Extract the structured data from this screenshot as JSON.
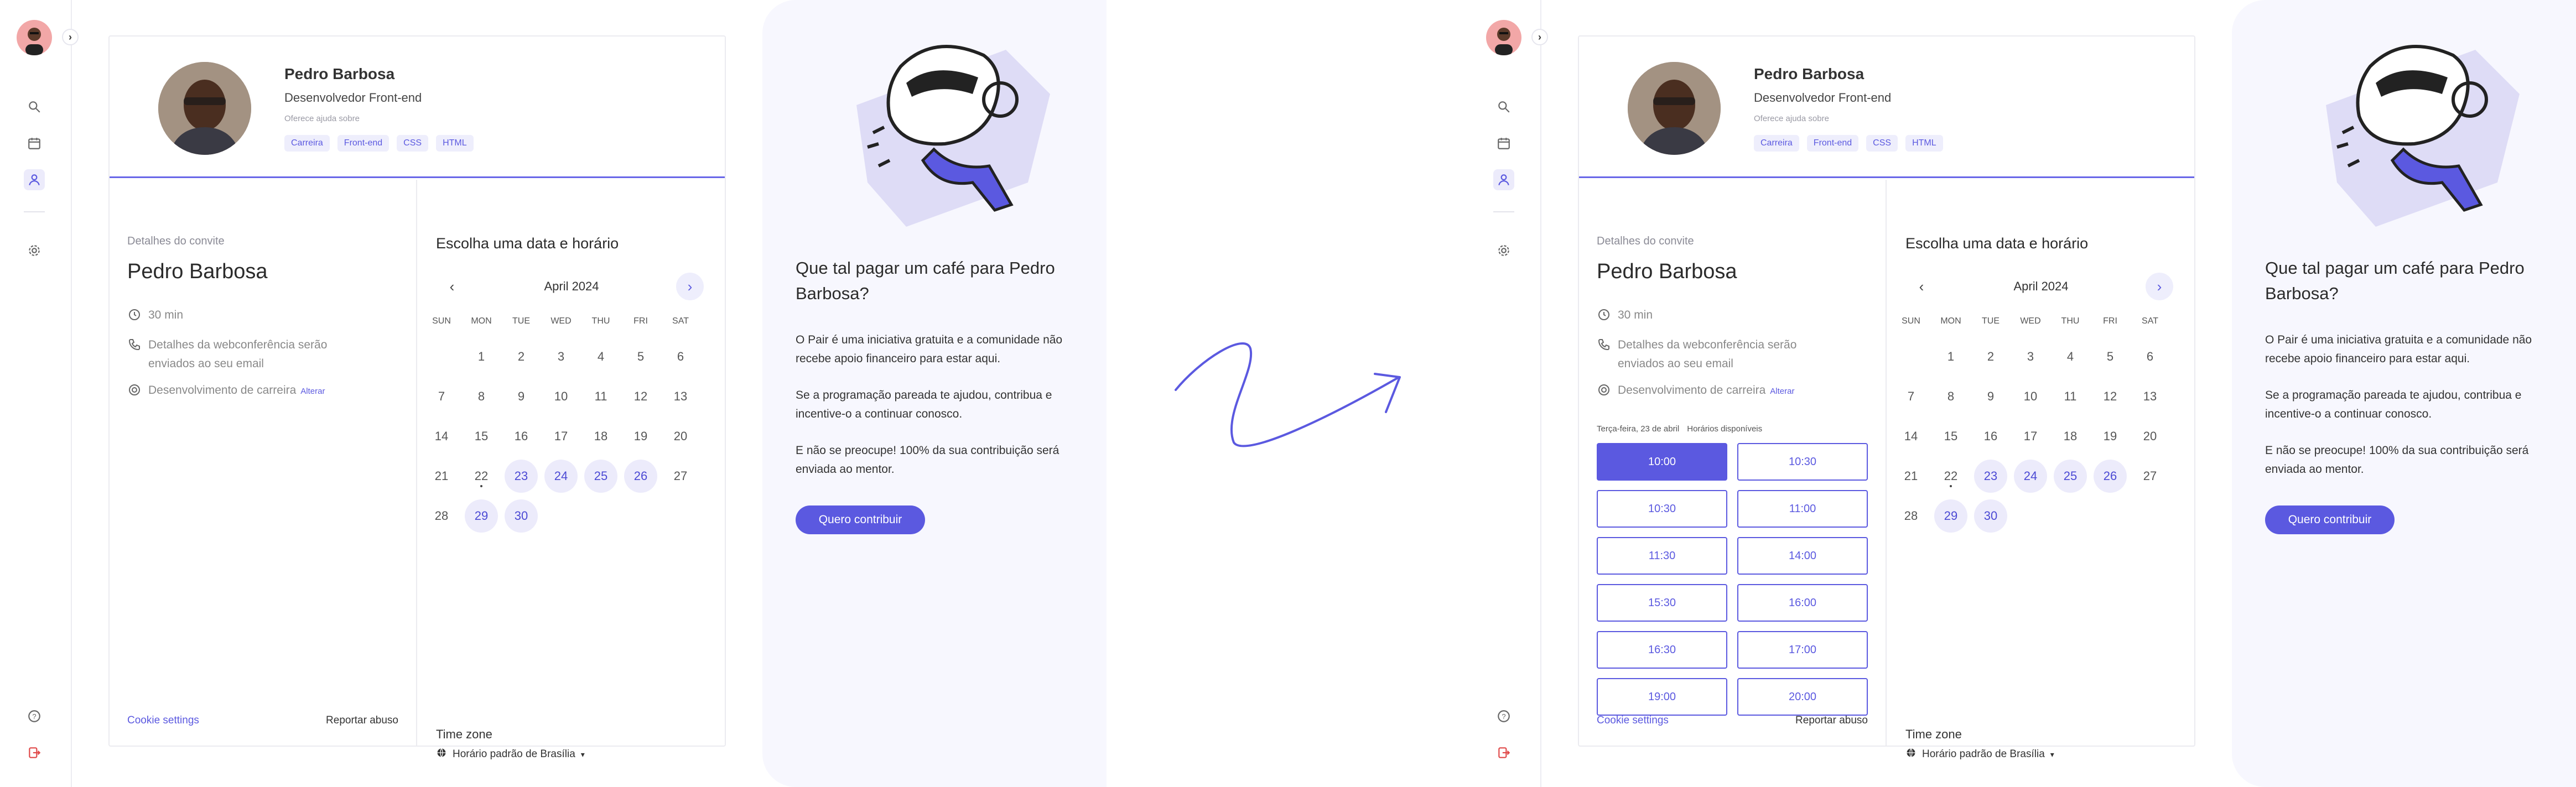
{
  "profile": {
    "name": "Pedro Barbosa",
    "role": "Desenvolvedor Front-end",
    "help_label": "Oferece ajuda sobre",
    "tags": [
      "Carreira",
      "Front-end",
      "CSS",
      "HTML"
    ]
  },
  "invite": {
    "label": "Detalhes do convite",
    "name": "Pedro Barbosa",
    "duration": "30 min",
    "conference_line1": "Detalhes da webconferência serão",
    "conference_line2": "enviados ao seu email",
    "topic": "Desenvolvimento de carreira",
    "change_link": "Alterar"
  },
  "slots": {
    "date_label": "Terça-feira, 23 de abril",
    "available_label": "Horários disponíveis",
    "times": [
      "10:00",
      "10:30",
      "10:30",
      "11:00",
      "11:30",
      "14:00",
      "15:30",
      "16:00",
      "16:30",
      "17:00",
      "19:00",
      "20:00"
    ],
    "selected_index": 0
  },
  "footer": {
    "cookie": "Cookie settings",
    "report": "Reportar abuso"
  },
  "calendar": {
    "title": "Escolha uma data e horário",
    "month": "April 2024",
    "prev_icon": "chevron-left-icon",
    "next_icon": "chevron-right-icon",
    "weekdays": [
      "SUN",
      "MON",
      "TUE",
      "WED",
      "THU",
      "FRI",
      "SAT"
    ],
    "first_weekday_index": 1,
    "days_in_month": 30,
    "available_days": [
      23,
      24,
      25,
      26,
      29,
      30
    ],
    "today": 22,
    "timezone_label": "Time zone",
    "timezone_value": "Horário padrão de Brasília"
  },
  "coffee": {
    "title": "Que tal pagar um café para Pedro Barbosa?",
    "p1": "O Pair é uma iniciativa gratuita e a comunidade não recebe apoio financeiro para estar aqui.",
    "p2": "Se a programação pareada te ajudou, contribua e incentive-o a continuar conosco.",
    "p3": "E não se preocupe! 100% da sua contribuição será enviada ao mentor.",
    "button": "Quero contribuir"
  },
  "colors": {
    "accent": "#5b59e0",
    "accent_light": "#ecebfb",
    "panel_bg": "#f7f7fe"
  },
  "icons": [
    "search-icon",
    "calendar-icon",
    "user-icon",
    "gear-icon",
    "help-icon",
    "logout-icon",
    "clock-icon",
    "phone-icon",
    "target-icon",
    "globe-icon"
  ]
}
